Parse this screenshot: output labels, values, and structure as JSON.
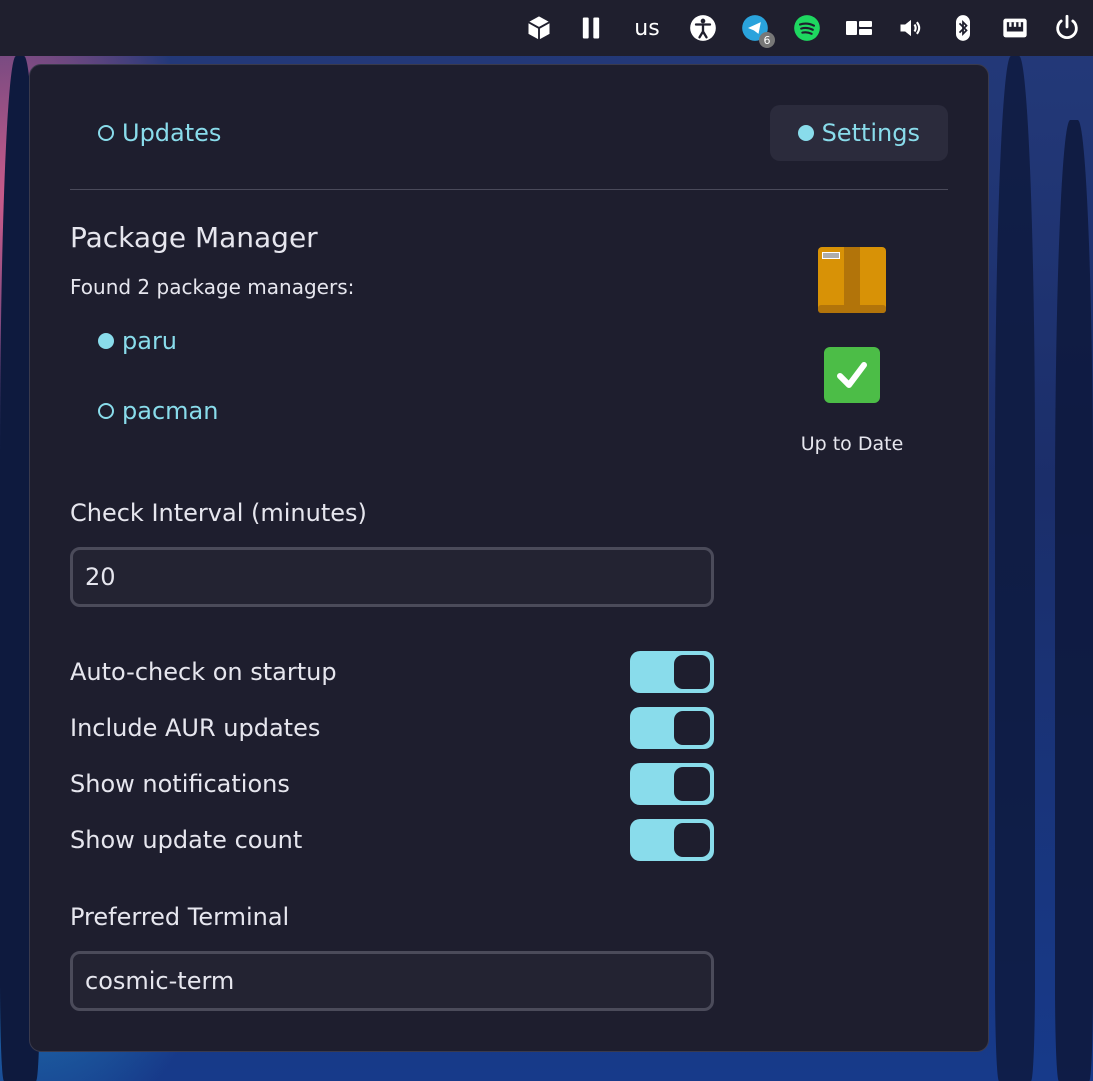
{
  "topbar": {
    "keyboard_layout": "us",
    "telegram_badge": "6",
    "icons": [
      "package-icon",
      "pause-icon",
      "accessibility-icon",
      "telegram-icon",
      "spotify-icon",
      "workspaces-icon",
      "volume-icon",
      "bluetooth-icon",
      "network-icon",
      "power-icon"
    ]
  },
  "tabs": {
    "updates": "Updates",
    "settings": "Settings",
    "active": "settings"
  },
  "package_manager": {
    "title": "Package Manager",
    "found_text": "Found 2 package managers:",
    "options": [
      {
        "label": "paru",
        "selected": true
      },
      {
        "label": "pacman",
        "selected": false
      }
    ]
  },
  "status": {
    "text": "Up to Date",
    "icons": [
      "package-box-icon",
      "check-mark-icon"
    ]
  },
  "check_interval": {
    "label": "Check Interval (minutes)",
    "value": "20"
  },
  "toggles": [
    {
      "label": "Auto-check on startup",
      "on": true
    },
    {
      "label": "Include AUR updates",
      "on": true
    },
    {
      "label": "Show notifications",
      "on": true
    },
    {
      "label": "Show update count",
      "on": true
    }
  ],
  "terminal": {
    "label": "Preferred Terminal",
    "value": "cosmic-term"
  },
  "colors": {
    "accent": "#89dceb",
    "panel": "#1e1e2e",
    "topbar": "#1f1f2e"
  }
}
